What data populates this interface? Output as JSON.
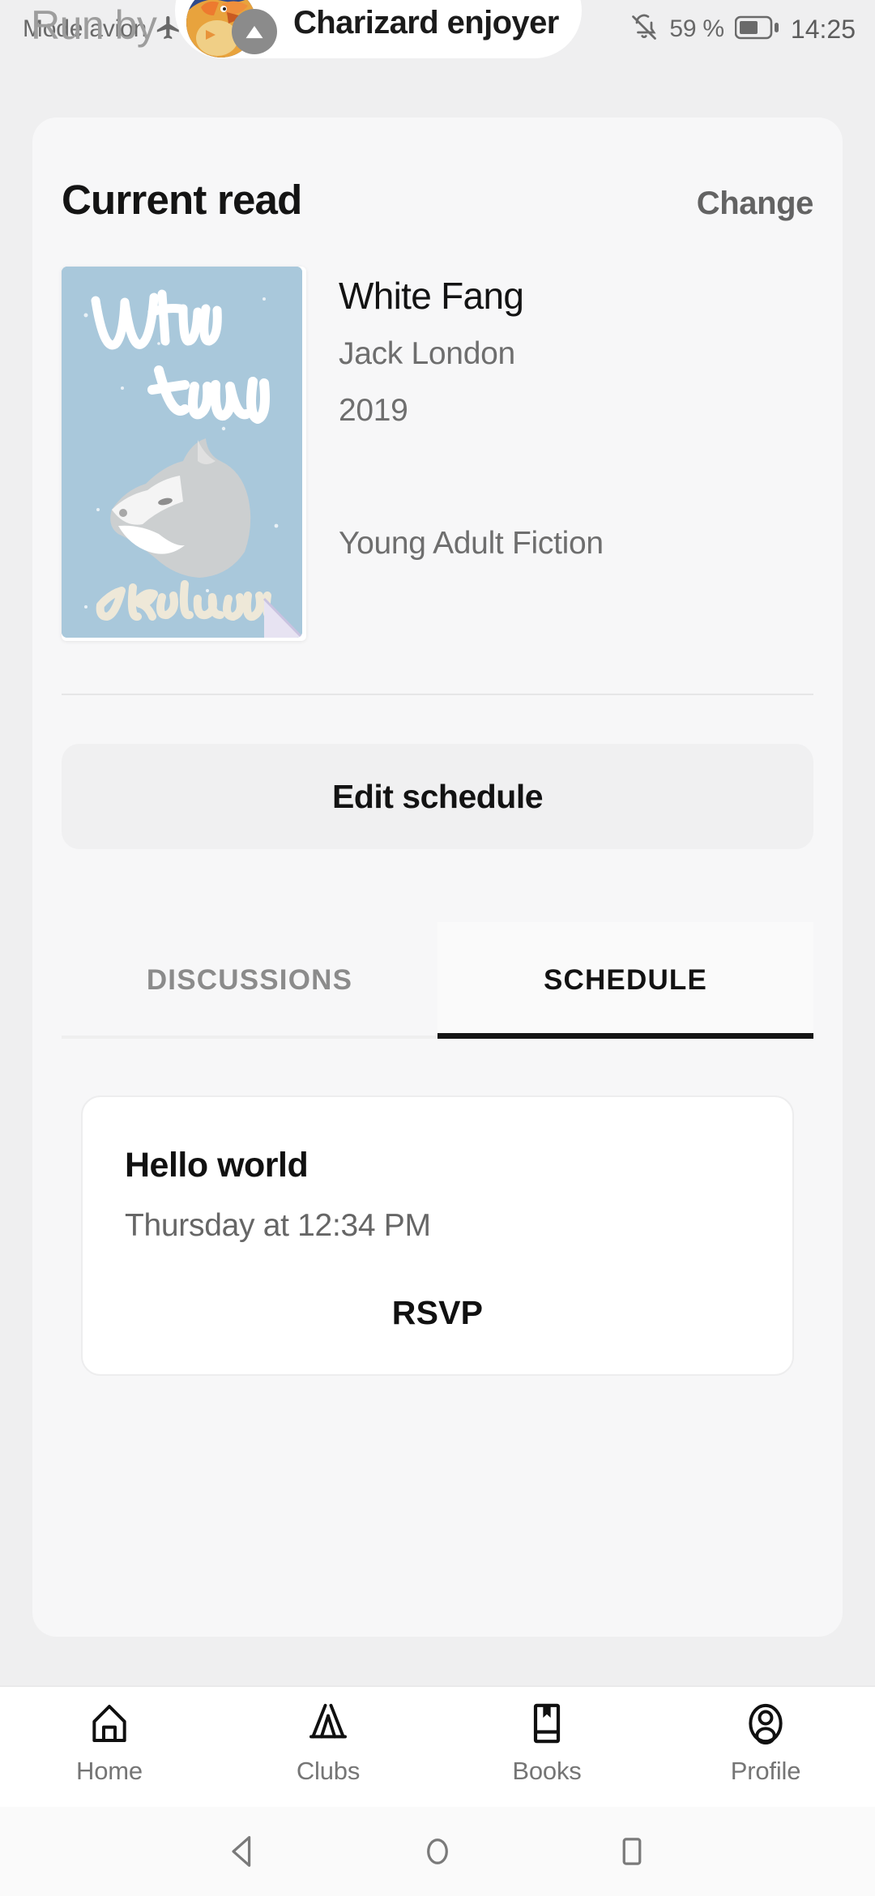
{
  "statusbar": {
    "left_text": "Mode avion",
    "airplane_icon": "airplane-mode-icon",
    "bell_icon": "bell-muted-icon",
    "battery_percent": "59 %",
    "battery_icon": "battery-icon",
    "time": "14:25"
  },
  "header": {
    "run_by_label": "Run by",
    "owner_name": "Charizard enjoyer",
    "owner_avatar_icon": "charizard-avatar",
    "owner_badge_icon": "chevron-up-badge-icon"
  },
  "card": {
    "title": "Current read",
    "change_label": "Change",
    "book": {
      "cover_title_line1": "White",
      "cover_title_line2": "Fang",
      "cover_author": "Jack London",
      "cover_icon": "wolf-illustration",
      "title": "White Fang",
      "author": "Jack London",
      "year": "2019",
      "genre": "Young Adult Fiction"
    },
    "edit_schedule_label": "Edit schedule",
    "tabs": [
      {
        "label": "DISCUSSIONS",
        "active": false
      },
      {
        "label": "SCHEDULE",
        "active": true
      }
    ],
    "schedule_items": [
      {
        "title": "Hello world",
        "when": "Thursday at 12:34 PM",
        "rsvp_label": "RSVP"
      }
    ]
  },
  "bottom_nav": [
    {
      "label": "Home",
      "icon": "home-icon"
    },
    {
      "label": "Clubs",
      "icon": "tent-icon"
    },
    {
      "label": "Books",
      "icon": "book-bookmark-icon"
    },
    {
      "label": "Profile",
      "icon": "profile-icon"
    }
  ],
  "android_nav": [
    {
      "icon": "back-triangle-icon"
    },
    {
      "icon": "home-circle-icon"
    },
    {
      "icon": "recents-square-icon"
    }
  ],
  "colors": {
    "page_background": "#efeff0",
    "card_background": "#f7f7f8",
    "cover_background": "#a9c8db",
    "accent_active": "#141414",
    "muted_text": "#6e6e6e"
  }
}
